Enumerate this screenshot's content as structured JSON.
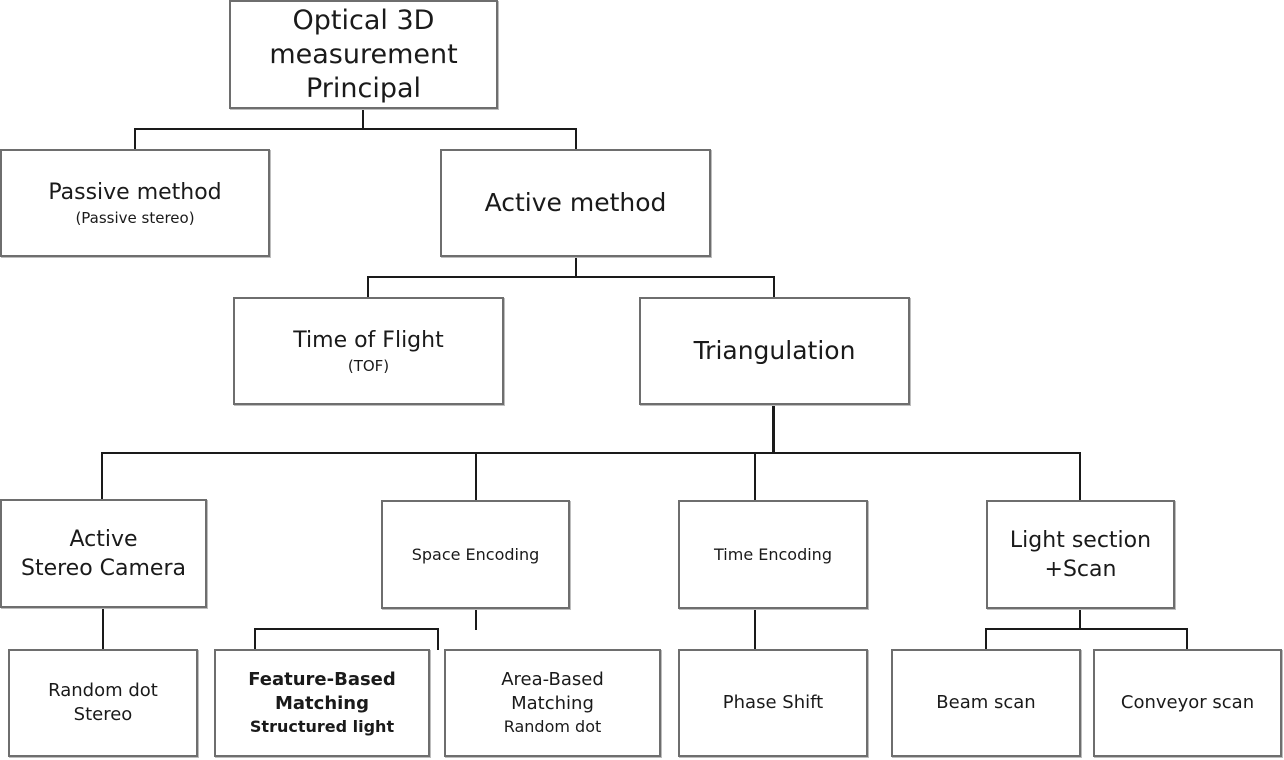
{
  "diagram": {
    "type": "tree",
    "root": {
      "id": "root",
      "lines": [
        "Optical 3D",
        "measurement",
        "Principal"
      ]
    },
    "level1": [
      {
        "id": "passive",
        "title": "Passive method",
        "subtitle": "(Passive stereo)"
      },
      {
        "id": "active",
        "title": "Active method"
      }
    ],
    "level2": [
      {
        "id": "tof",
        "title": "Time of Flight",
        "subtitle": "(TOF)"
      },
      {
        "id": "triangulation",
        "title": "Triangulation"
      }
    ],
    "level3": [
      {
        "id": "active-stereo",
        "lines": [
          "Active",
          "Stereo Camera"
        ]
      },
      {
        "id": "space-encoding",
        "title": "Space Encoding"
      },
      {
        "id": "time-encoding",
        "title": "Time Encoding"
      },
      {
        "id": "light-section",
        "lines": [
          "Light section",
          "+Scan"
        ]
      }
    ],
    "level4": [
      {
        "id": "random-dot-stereo",
        "lines": [
          "Random dot",
          "Stereo"
        ],
        "parent": "active-stereo"
      },
      {
        "id": "feature-based",
        "lines": [
          "Feature-Based",
          "Matching"
        ],
        "subtitle": "Structured light",
        "parent": "space-encoding"
      },
      {
        "id": "area-based",
        "lines": [
          "Area-Based",
          "Matching"
        ],
        "subtitle": "Random dot",
        "parent": "space-encoding"
      },
      {
        "id": "phase-shift",
        "title": "Phase Shift",
        "parent": "time-encoding"
      },
      {
        "id": "beam-scan",
        "title": "Beam scan",
        "parent": "light-section"
      },
      {
        "id": "conveyor-scan",
        "title": "Conveyor scan",
        "parent": "light-section"
      }
    ],
    "edges": [
      [
        "root",
        "passive"
      ],
      [
        "root",
        "active"
      ],
      [
        "active",
        "tof"
      ],
      [
        "active",
        "triangulation"
      ],
      [
        "triangulation",
        "active-stereo"
      ],
      [
        "triangulation",
        "space-encoding"
      ],
      [
        "triangulation",
        "time-encoding"
      ],
      [
        "triangulation",
        "light-section"
      ],
      [
        "active-stereo",
        "random-dot-stereo"
      ],
      [
        "space-encoding",
        "feature-based"
      ],
      [
        "space-encoding",
        "area-based"
      ],
      [
        "time-encoding",
        "phase-shift"
      ],
      [
        "light-section",
        "beam-scan"
      ],
      [
        "light-section",
        "conveyor-scan"
      ]
    ],
    "colors": {
      "border": "#6e6e6e",
      "line": "#1a1a1a",
      "text": "#1a1a1a",
      "background": "#ffffff"
    }
  }
}
